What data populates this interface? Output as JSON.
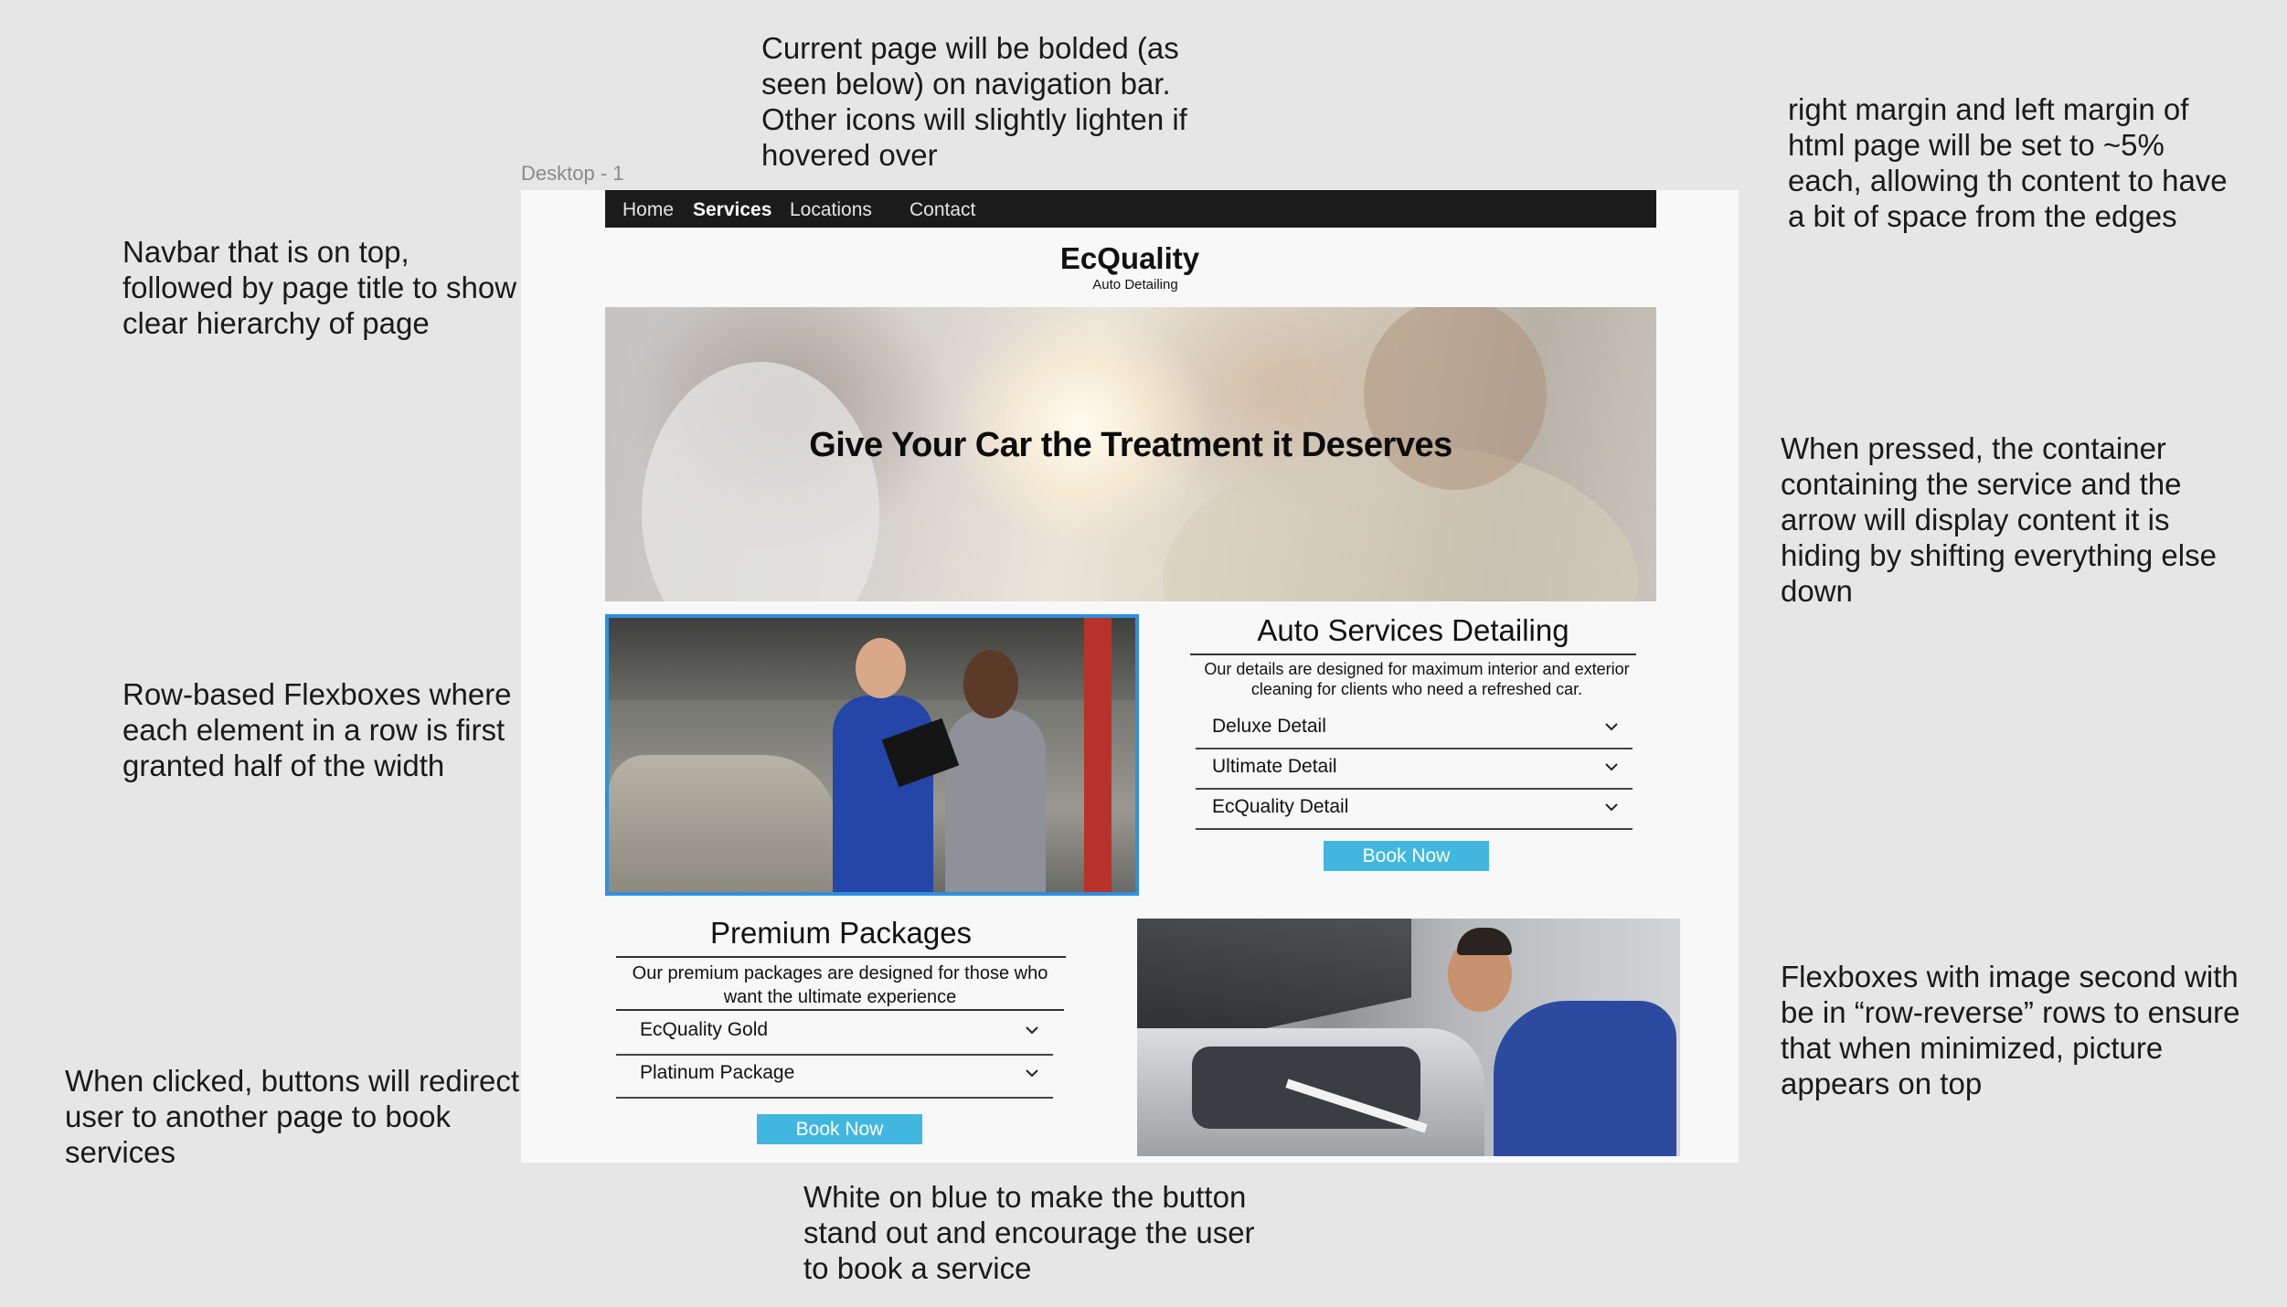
{
  "annotations": {
    "navbar_note": "Navbar that is on top, followed by page title to show clear hierarchy of page",
    "current_page_note": "Current page will be bolded (as seen below) on navigation bar. Other icons will slightly lighten if hovered over",
    "margin_note": "right margin and left margin of html page will be set to ~5% each, allowing th content to have a bit of space from the edges",
    "row_flex_note": "Row-based Flexboxes where each element in a row is first granted half of the width",
    "pressed_note": "When pressed, the container containing the service and the arrow will display content it is hiding by shifting everything else down",
    "row_reverse_note": "Flexboxes with image second with be in “row-reverse” rows to ensure that when minimized, picture appears on top",
    "clicked_note": "When clicked, buttons will redirect user to another page to book services",
    "white_blue_note": "White on blue to make the button stand out and encourage the user to book a service"
  },
  "frame": {
    "label": "Desktop - 1"
  },
  "navbar": {
    "items": [
      "Home",
      "Services",
      "Locations",
      "Contact"
    ],
    "active": "Services"
  },
  "brand": {
    "name": "EcQuality",
    "tagline": "Auto Detailing"
  },
  "hero": {
    "title": "Give Your Car the Treatment it Deserves"
  },
  "services": {
    "title": "Auto Services Detailing",
    "description": "Our details are designed for maximum interior and exterior cleaning for clients who need a refreshed car.",
    "items": [
      "Deluxe Detail",
      "Ultimate Detail",
      "EcQuality Detail"
    ],
    "button": "Book Now"
  },
  "packages": {
    "title": "Premium Packages",
    "description": "Our premium packages are designed for those who want the ultimate experience",
    "items": [
      "EcQuality Gold",
      "Platinum Package"
    ],
    "button": "Book Now"
  },
  "colors": {
    "navbar_bg": "#1b1b1b",
    "button_bg": "#41b7df",
    "image_border": "#2f8fdd",
    "page_bg": "#f8f8f8",
    "canvas_bg": "#e6e6e6"
  }
}
